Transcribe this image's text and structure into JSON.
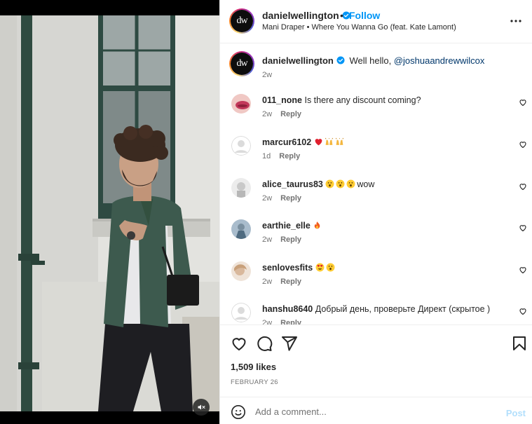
{
  "post": {
    "username": "danielwellington",
    "follow_label": "Follow",
    "separator": "•",
    "audio": "Mani Draper • Where You Wanna Go (feat. Kate Lamont)",
    "avatar_monogram": "dw",
    "more_icon": "more-horizontal-icon",
    "mute_icon": "speaker-muted-icon"
  },
  "caption": {
    "username": "danielwellington",
    "text": "Well hello, ",
    "mention": "@joshuaandrewwilcox",
    "time": "2w"
  },
  "comments": [
    {
      "username": "011_none",
      "text": "Is there any discount coming?",
      "time": "2w",
      "reply": "Reply",
      "emojis": []
    },
    {
      "username": "marcur6102",
      "text": "",
      "time": "1d",
      "reply": "Reply",
      "emojis": [
        "red-heart",
        "raising-hands",
        "raising-hands"
      ]
    },
    {
      "username": "alice_taurus83",
      "text": "wow",
      "time": "2w",
      "reply": "Reply",
      "emojis": [
        "astonished-face",
        "astonished-face",
        "astonished-face"
      ]
    },
    {
      "username": "earthie_elle",
      "text": "",
      "time": "2w",
      "reply": "Reply",
      "emojis": [
        "fire"
      ]
    },
    {
      "username": "senlovesfits",
      "text": "",
      "time": "2w",
      "reply": "Reply",
      "emojis": [
        "heart-eyes-face",
        "astonished-face"
      ]
    },
    {
      "username": "hanshu8640",
      "text": "Добрый день, проверьте Директ (скрытое )",
      "time": "2w",
      "reply": "Reply",
      "emojis": []
    }
  ],
  "actions": {
    "likes": "1,509 likes",
    "date": "FEBRUARY 26",
    "icons": [
      "heart-outline-icon",
      "comment-icon",
      "share-icon",
      "bookmark-icon"
    ]
  },
  "composer": {
    "placeholder": "Add a comment...",
    "post_label": "Post"
  },
  "colors": {
    "link_blue": "#0095f6",
    "post_disabled": "#b2dffc",
    "text_primary": "#262626",
    "text_secondary": "#737373",
    "jacket_green": "#3d5a4e"
  }
}
